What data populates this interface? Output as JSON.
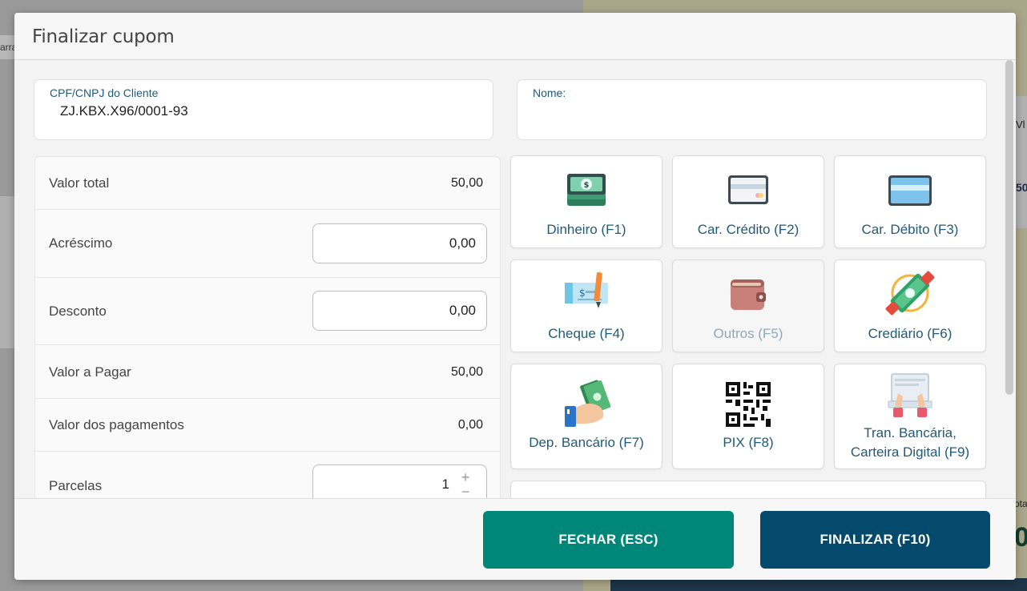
{
  "modal": {
    "title": "Finalizar cupom"
  },
  "background": {
    "left_peek": "arra",
    "right_peek_1": "Vl",
    "right_peek_2": "50",
    "right_peek_3": "ota",
    "right_peek_4": "0"
  },
  "customer": {
    "document_label": "CPF/CNPJ do Cliente",
    "document_value": "ZJ.KBX.X96/0001-93",
    "name_label": "Nome:",
    "name_value": ""
  },
  "totals": {
    "valor_total_label": "Valor total",
    "valor_total": "50,00",
    "acrescimo_label": "Acréscimo",
    "acrescimo": "0,00",
    "desconto_label": "Desconto",
    "desconto": "0,00",
    "valor_pagar_label": "Valor a Pagar",
    "valor_pagar": "50,00",
    "valor_pagamentos_label": "Valor dos pagamentos",
    "valor_pagamentos": "0,00",
    "parcelas_label": "Parcelas",
    "parcelas": "1"
  },
  "payments": [
    {
      "label": "Dinheiro (F1)",
      "icon": "cash-icon"
    },
    {
      "label": "Car. Crédito (F2)",
      "icon": "credit-card-icon"
    },
    {
      "label": "Car. Débito (F3)",
      "icon": "debit-card-icon"
    },
    {
      "label": "Cheque (F4)",
      "icon": "cheque-icon"
    },
    {
      "label": "Outros (F5)",
      "icon": "wallet-icon",
      "disabled": true
    },
    {
      "label": "Crediário (F6)",
      "icon": "installment-icon"
    },
    {
      "label": "Dep. Bancário (F7)",
      "icon": "bank-deposit-icon"
    },
    {
      "label": "PIX (F8)",
      "icon": "qr-code-icon"
    },
    {
      "label_line1": "Tran. Bancária,",
      "label_line2": "Carteira Digital (F9)",
      "icon": "digital-wallet-icon"
    }
  ],
  "footer": {
    "close_label": "FECHAR (ESC)",
    "finish_label": "FINALIZAR (F10)"
  },
  "colors": {
    "primary_teal": "#00877a",
    "primary_navy": "#034a6c",
    "label_blue": "#1f5a7a"
  }
}
